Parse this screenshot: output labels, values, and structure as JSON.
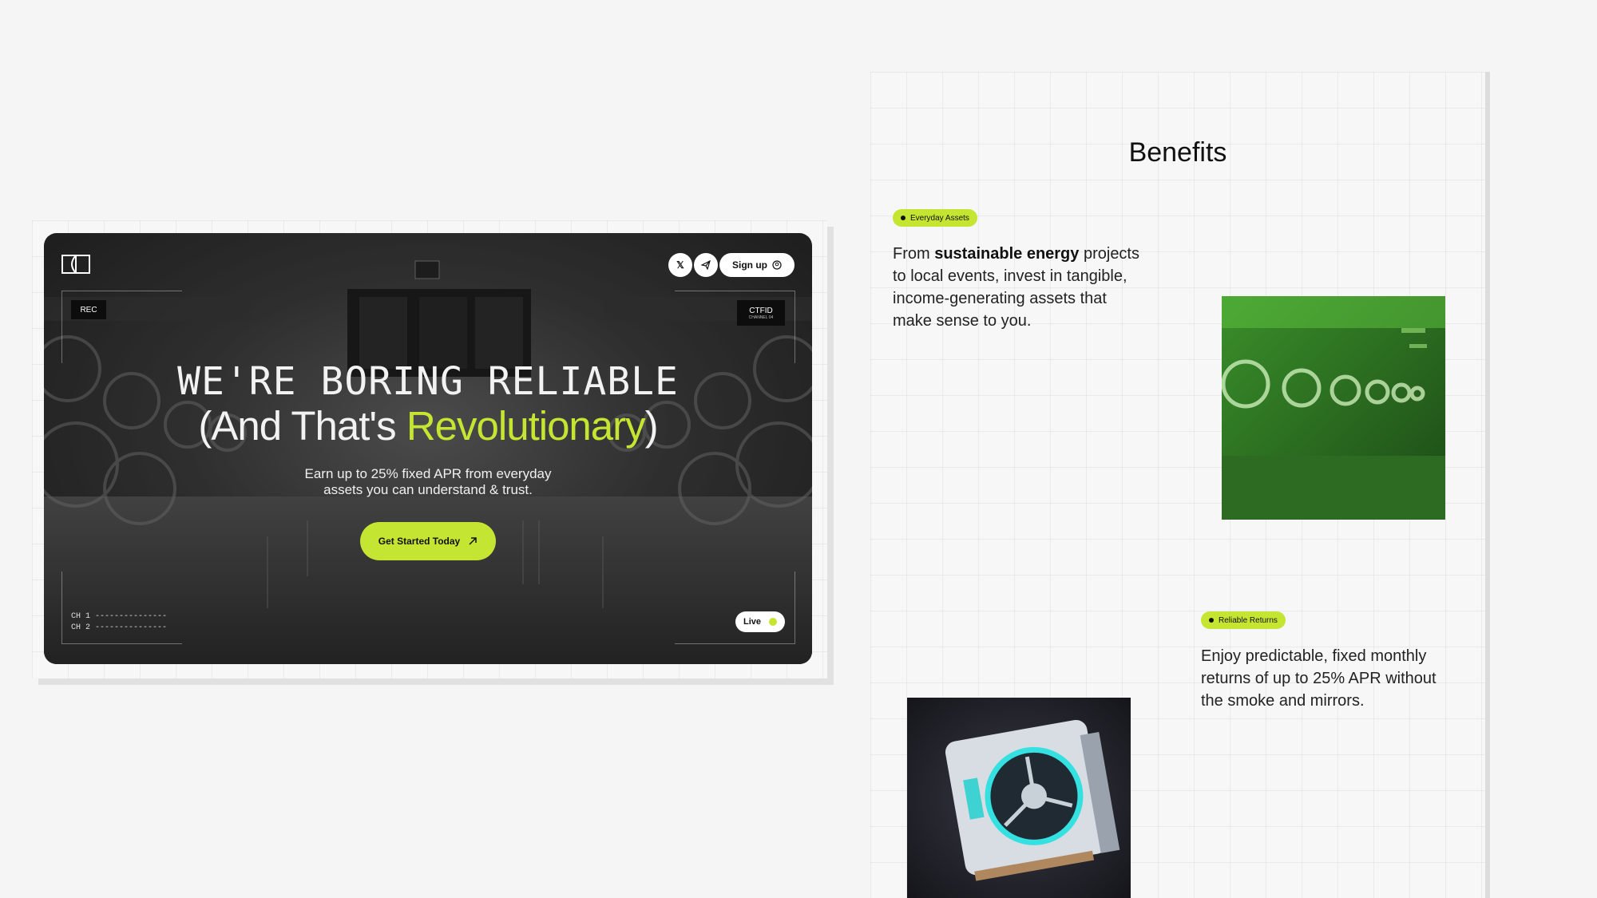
{
  "hero": {
    "logo_icon": "window-logo-icon",
    "social": {
      "x_icon": "x-icon",
      "telegram_icon": "telegram-icon"
    },
    "signup_label": "Sign up",
    "signup_icon": "user-circle-icon",
    "rec_label": "REC",
    "ctfid_label": "CTFID",
    "ctfid_sub": "CHANNEL 04",
    "headline_mono": "WE'RE BORING RELIABLE",
    "headline_prefix": "(And That's ",
    "headline_accent": "Revolutionary",
    "headline_suffix": ")",
    "subtext": "Earn up to 25% fixed APR from everyday assets you can understand & trust.",
    "cta_label": "Get Started Today",
    "cta_icon": "arrow-up-right-icon",
    "channels": [
      "CH 1 ---------------",
      "CH 2 ---------------"
    ],
    "live_label": "Live",
    "accent_color": "#c4e632"
  },
  "benefits": {
    "title": "Benefits",
    "items": [
      {
        "tag": "Everyday Assets",
        "text_prefix": "From ",
        "text_bold": "sustainable energy",
        "text_suffix": " projects to local events, invest in tangible, income-generating assets that make sense to you."
      },
      {
        "tag": "Reliable Returns",
        "text": "Enjoy predictable, fixed monthly returns of up to 25% APR without the smoke and mirrors."
      }
    ]
  }
}
